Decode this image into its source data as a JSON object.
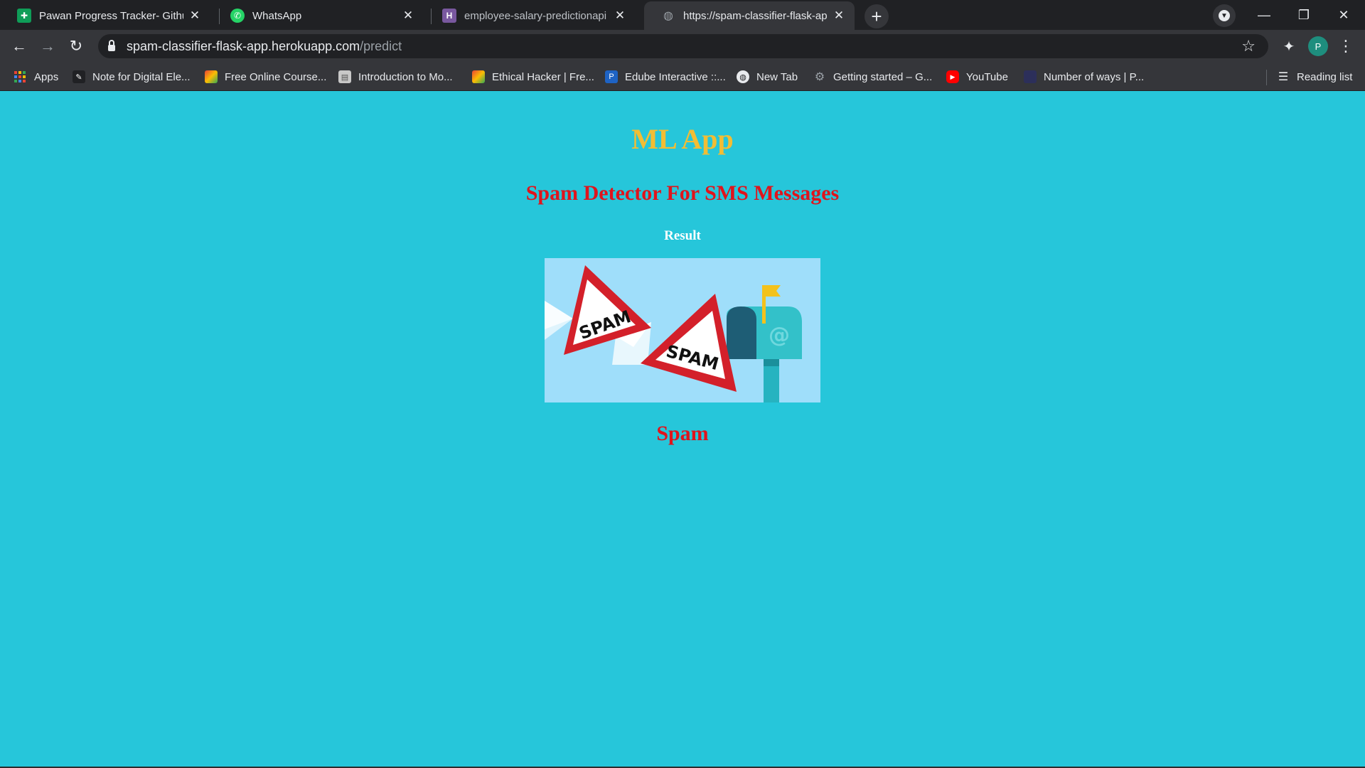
{
  "browser": {
    "tabs": [
      {
        "title": "Pawan Progress Tracker- Github I",
        "icon": "google-sheets-icon",
        "color": "#0f9d58",
        "active": false
      },
      {
        "title": "WhatsApp",
        "icon": "whatsapp-icon",
        "color": "#25d366",
        "active": false
      },
      {
        "title": "employee-salary-predictionapi · ",
        "icon": "heroku-icon",
        "color": "#79589f",
        "active": false
      },
      {
        "title": "https://spam-classifier-flask-app.",
        "icon": "globe-icon",
        "color": "#9aa0a6",
        "active": true
      }
    ],
    "address": {
      "host": "spam-classifier-flask-app.herokuapp.com",
      "path": "/predict"
    },
    "profile_initial": "P",
    "bookmarks": [
      {
        "label": "Apps",
        "icon": "apps-grid-icon"
      },
      {
        "label": "Note for Digital Ele...",
        "icon": "notes-icon"
      },
      {
        "label": "Free Online Course...",
        "icon": "course-icon"
      },
      {
        "label": "Introduction to Mo...",
        "icon": "document-icon"
      },
      {
        "label": "Ethical Hacker | Fre...",
        "icon": "course-icon"
      },
      {
        "label": "Edube Interactive ::...",
        "icon": "edube-icon"
      },
      {
        "label": "New Tab",
        "icon": "globe-icon"
      },
      {
        "label": "Getting started – G...",
        "icon": "gear-icon"
      },
      {
        "label": "YouTube",
        "icon": "youtube-icon"
      },
      {
        "label": "Number of ways | P...",
        "icon": "bookmark-icon"
      }
    ],
    "reading_list": "Reading list"
  },
  "page": {
    "title": "ML App",
    "subtitle": "Spam Detector For SMS Messages",
    "result_label": "Result",
    "image_text": "SPAM",
    "prediction": "Spam"
  },
  "colors": {
    "page_background": "#26c6da",
    "title": "#f2bd34",
    "subtitle": "#e0141c",
    "prediction": "#e0141c"
  }
}
